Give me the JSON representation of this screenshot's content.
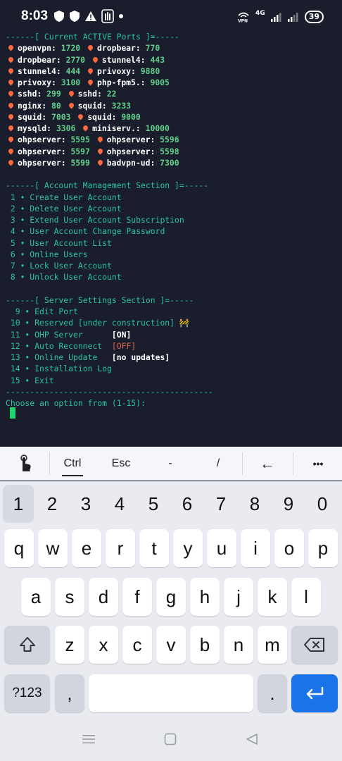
{
  "status_bar": {
    "time": "8:03",
    "network": "4G",
    "battery": "39",
    "left_icons": [
      "shield-icon",
      "shield-icon",
      "warning-icon",
      "hand-icon",
      "dot-icon"
    ],
    "right_icons": [
      "vpn-icon",
      "signal-icon",
      "signal-icon",
      "battery-icon"
    ]
  },
  "terminal": {
    "ports_header": "------[ Current ACTIVE Ports ]=-----",
    "ports": [
      [
        {
          "name": "openvpn:",
          "port": "1720"
        },
        {
          "name": "dropbear:",
          "port": "770"
        }
      ],
      [
        {
          "name": "dropbear:",
          "port": "2770"
        },
        {
          "name": "stunnel4:",
          "port": "443"
        }
      ],
      [
        {
          "name": "stunnel4:",
          "port": "444"
        },
        {
          "name": "privoxy:",
          "port": "9880"
        }
      ],
      [
        {
          "name": "privoxy:",
          "port": "3100"
        },
        {
          "name": "php-fpm5.:",
          "port": "9005"
        }
      ],
      [
        {
          "name": "sshd:",
          "port": "299"
        },
        {
          "name": "sshd:",
          "port": "22"
        }
      ],
      [
        {
          "name": "nginx:",
          "port": "80"
        },
        {
          "name": "squid:",
          "port": "3233"
        }
      ],
      [
        {
          "name": "squid:",
          "port": "7003"
        },
        {
          "name": "squid:",
          "port": "9000"
        }
      ],
      [
        {
          "name": "mysqld:",
          "port": "3306"
        },
        {
          "name": "miniserv.:",
          "port": "10000"
        }
      ],
      [
        {
          "name": "ohpserver:",
          "port": "5595"
        },
        {
          "name": "ohpserver:",
          "port": "5596"
        }
      ],
      [
        {
          "name": "ohpserver:",
          "port": "5597"
        },
        {
          "name": "ohpserver:",
          "port": "5598"
        }
      ],
      [
        {
          "name": "ohpserver:",
          "port": "5599"
        },
        {
          "name": "badvpn-ud:",
          "port": "7300"
        }
      ]
    ],
    "account_header": "------[ Account Management Section ]=-----",
    "account_items": [
      " 1 • Create User Account",
      " 2 • Delete User Account",
      " 3 • Extend User Account Subscription",
      " 4 • User Account Change Password",
      " 5 • User Account List",
      " 6 • Online Users",
      " 7 • Lock User Account",
      " 8 • Unlock User Account"
    ],
    "server_header": "------[ Server Settings Section ]=-----",
    "server_items": [
      {
        "text": "  9 • Edit Port",
        "status": "",
        "status_color": ""
      },
      {
        "text": " 10 • Reserved [under construction] ",
        "status": "🚧",
        "status_color": "teal"
      },
      {
        "text": " 11 • OHP Server      ",
        "status": "[ON]",
        "status_color": "white"
      },
      {
        "text": " 12 • Auto Reconnect  ",
        "status": "[OFF]",
        "status_color": "red"
      },
      {
        "text": " 13 • Online Update   ",
        "status": "[no updates]",
        "status_color": "white"
      },
      {
        "text": " 14 • Installation Log",
        "status": "",
        "status_color": ""
      },
      {
        "text": " 15 • Exit",
        "status": "",
        "status_color": ""
      }
    ],
    "divider": "-------------------------------------------",
    "prompt": "Choose an option from (1-15):"
  },
  "extra_keys": {
    "hand_icon": "touch-icon",
    "ctrl": "Ctrl",
    "esc": "Esc",
    "dash": "-",
    "slash": "/",
    "left_arrow": "←",
    "more": "•••"
  },
  "keyboard": {
    "numbers": [
      "1",
      "2",
      "3",
      "4",
      "5",
      "6",
      "7",
      "8",
      "9",
      "0"
    ],
    "row1": [
      "q",
      "w",
      "e",
      "r",
      "t",
      "y",
      "u",
      "i",
      "o",
      "p"
    ],
    "row2": [
      "a",
      "s",
      "d",
      "f",
      "g",
      "h",
      "j",
      "k",
      "l"
    ],
    "row3": [
      "z",
      "x",
      "c",
      "v",
      "b",
      "n",
      "m"
    ],
    "symbols_label": "?123",
    "comma": ",",
    "period": "."
  },
  "colors": {
    "terminal_bg": "#1a1d2b",
    "teal": "#29c2a7",
    "green": "#5fd18c",
    "red": "#e0654f",
    "enter_blue": "#1a73e8"
  }
}
